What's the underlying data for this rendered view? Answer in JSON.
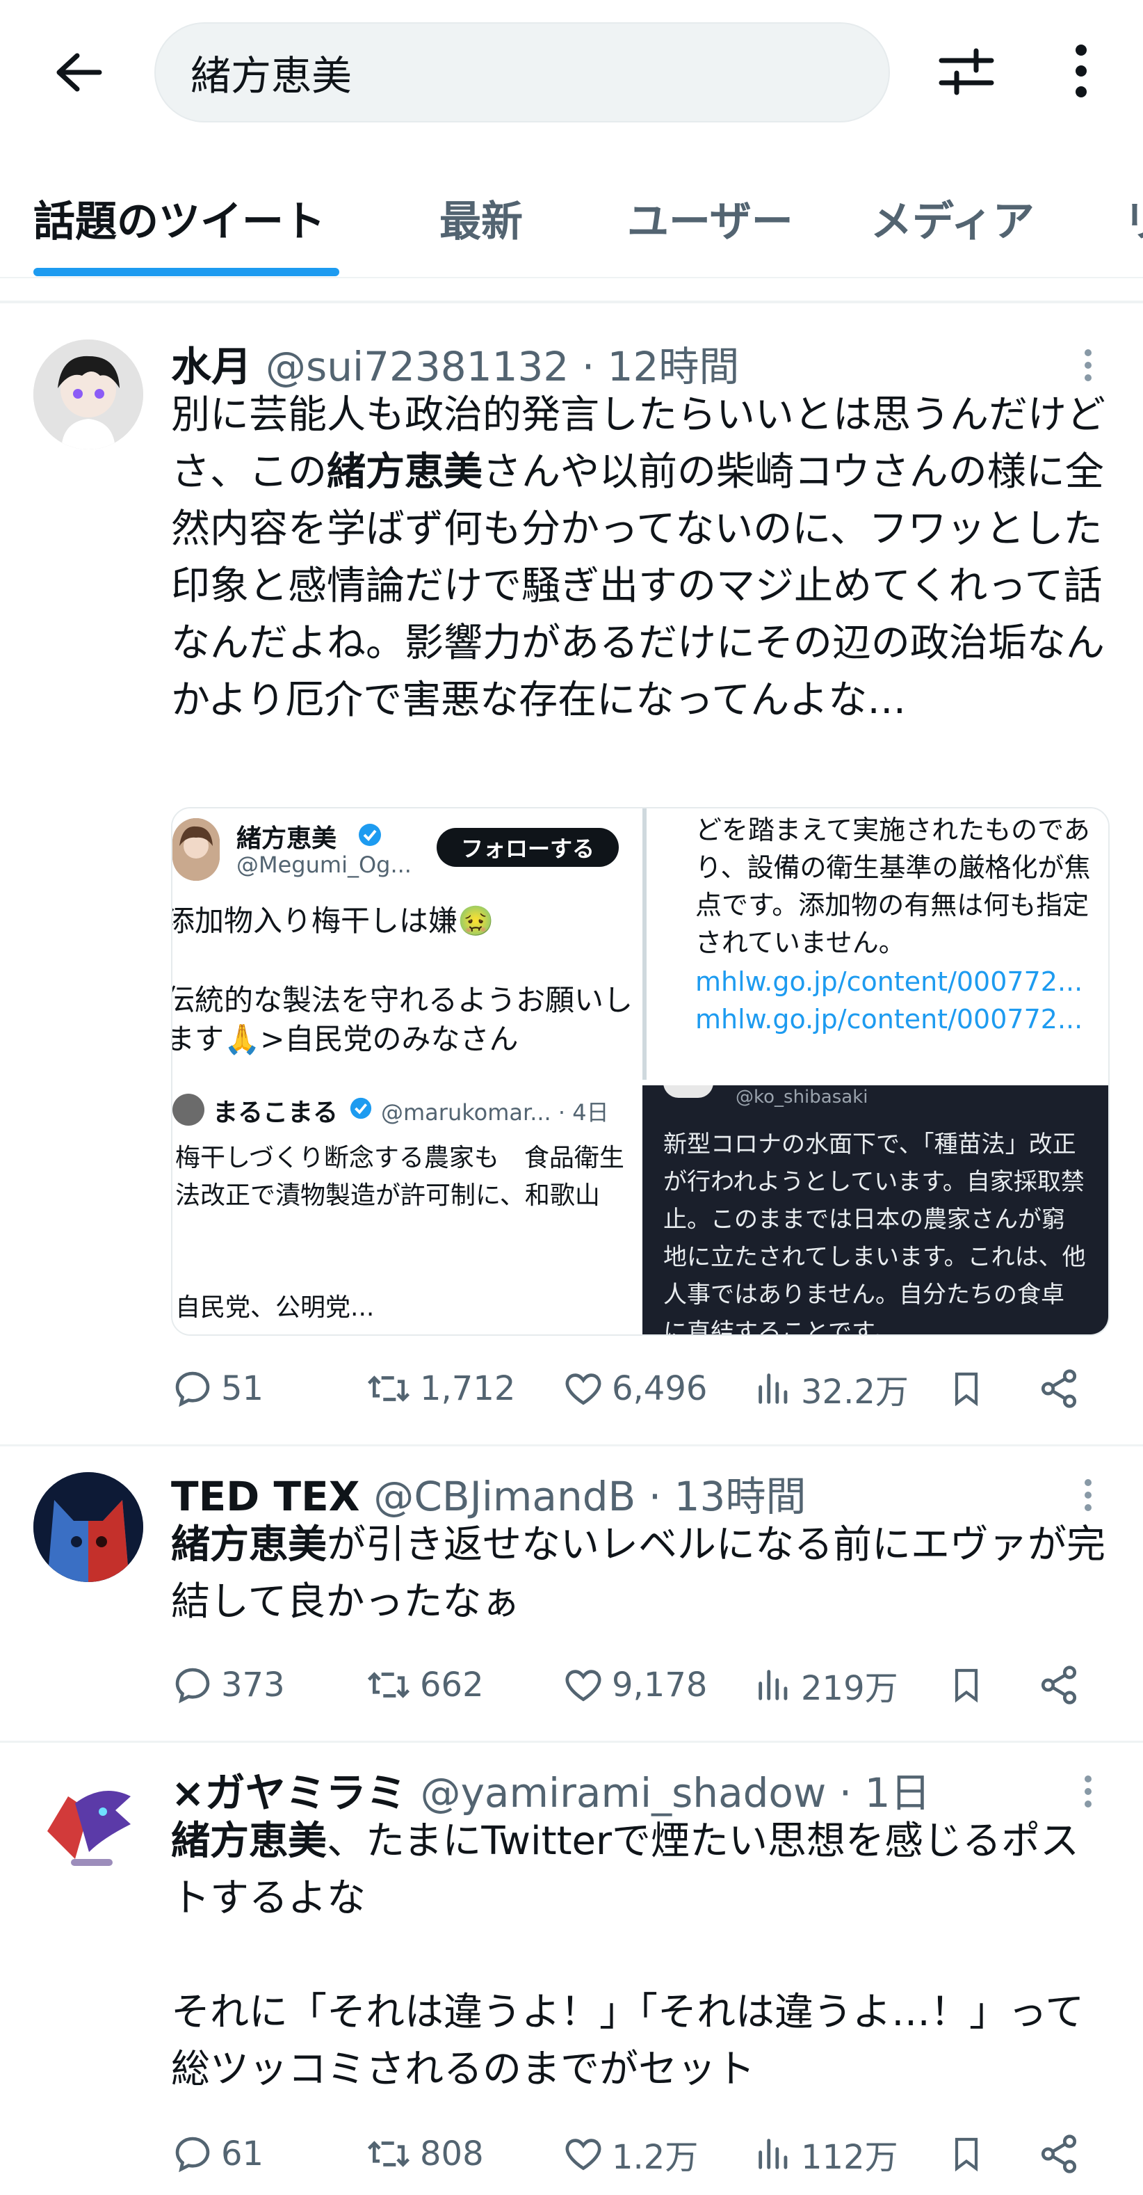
{
  "search": {
    "query": "緒方恵美"
  },
  "tabs": [
    {
      "label": "話題のツイート",
      "active": true
    },
    {
      "label": "最新"
    },
    {
      "label": "ユーザー"
    },
    {
      "label": "メディア"
    },
    {
      "label": "リ"
    }
  ],
  "tweets": [
    {
      "name": "水月",
      "handle": "@sui72381132 · 12時間",
      "text_parts": [
        "別に芸能人も政治的発言したらいいとは思うんだけどさ、この",
        "緒方恵美",
        "さんや以前の柴崎コウさんの様に全然内容を学ばず何も分かってないのに、フワッとした印象と感情論だけで騒ぎ出すのマジ止めてくれって話なんだよね。影響力があるだけにその辺の政治垢なんかより厄介で害悪な存在になってんよな…"
      ],
      "media": {
        "quote1": {
          "name": "緒方恵美",
          "handle": "@Megumi_Og...",
          "follow_label": "フォローする",
          "line1": "添加物入り梅干しは嫌🤢",
          "line2": "伝統的な製法を守れるようお願いします🙏>自民党のみなさん"
        },
        "quote2": {
          "text": "どを踏まえて実施されたものであり、設備の衛生基準の厳格化が焦点です。添加物の有無は何も指定されていません。",
          "link1": "mhlw.go.jp/content/000772...",
          "link2": "mhlw.go.jp/content/000772..."
        },
        "quote3": {
          "name": "まるこまる",
          "handle": "@marukomar... · 4日",
          "text": "梅干しづくり断念する農家も　食品衛生法改正で漬物製造が許可制に、和歌山",
          "footer": "自民党、公明党..."
        },
        "quote4": {
          "handle": "@ko_shibasaki",
          "text": "新型コロナの水面下で、「種苗法」改正が行われようとしています。自家採取禁止。このままでは日本の農家さんが窮地に立たされてしまいます。これは、他人事ではありません。自分たちの食卓に直結することです。"
        }
      },
      "stats": {
        "replies": "51",
        "retweets": "1,712",
        "likes": "6,496",
        "views": "32.2万"
      }
    },
    {
      "name": "TED TEX",
      "handle": "@CBJimandB · 13時間",
      "text_parts": [
        "",
        "緒方恵美",
        "が引き返せないレベルになる前にエヴァが完結して良かったなぁ"
      ],
      "stats": {
        "replies": "373",
        "retweets": "662",
        "likes": "9,178",
        "views": "219万"
      }
    },
    {
      "name": "×ガヤミラミ",
      "handle": "@yamirami_shadow · 1日",
      "text_parts": [
        "",
        "緒方恵美",
        "、たまにTwitterで煙たい思想を感じるポストするよな\n\nそれに「それは違うよ！」「それは違うよ…！」って総ツッコミされるのまでがセット"
      ],
      "stats": {
        "replies": "61",
        "retweets": "808",
        "likes": "1.2万",
        "views": "112万"
      }
    }
  ],
  "colors": {
    "accent": "#1d9bf0",
    "text": "#0f1419",
    "muted": "#536471",
    "search_bg": "#eff3f4"
  }
}
